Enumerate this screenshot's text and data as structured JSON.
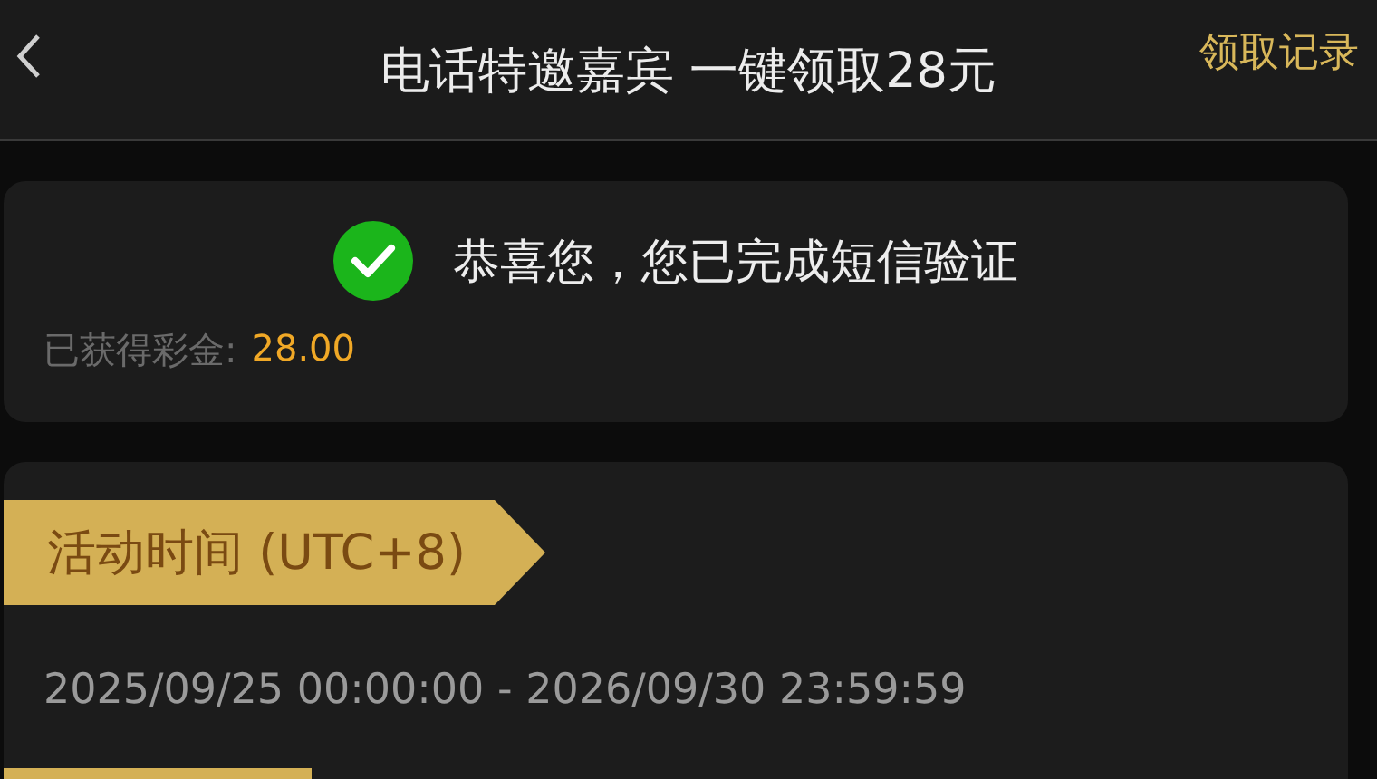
{
  "header": {
    "title": "电话特邀嘉宾 一键领取28元",
    "action": "领取记录"
  },
  "status_card": {
    "message": "恭喜您，您已完成短信验证",
    "bonus_label": "已获得彩金:",
    "bonus_value": "28.00"
  },
  "activity_card": {
    "ribbon": "活动时间 (UTC+8)",
    "period": "2025/09/25 00:00:00 - 2026/09/30 23:59:59"
  }
}
